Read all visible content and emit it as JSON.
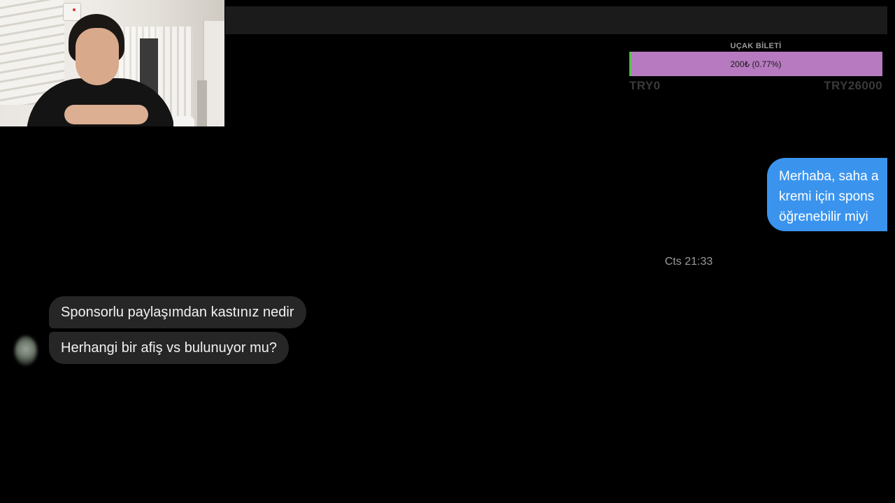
{
  "goal": {
    "title": "UÇAK BİLETİ",
    "progress_text": "200₺ (0.77%)",
    "progress_fraction": 0.0077,
    "min_label": "TRY0",
    "max_label": "TRY26000",
    "bar_color": "#b77ac0",
    "fill_color": "#5fbf54"
  },
  "chat": {
    "outgoing": {
      "lines": [
        "Merhaba, saha a",
        "kremi için spons",
        "öğrenebilir miyi"
      ],
      "color": "#3a94ee"
    },
    "timestamp": "Cts 21:33",
    "incoming": [
      {
        "text": "Sponsorlu paylaşımdan kastınız nedir"
      },
      {
        "text": "Herhangi bir afiş vs bulunuyor mu?"
      }
    ]
  }
}
